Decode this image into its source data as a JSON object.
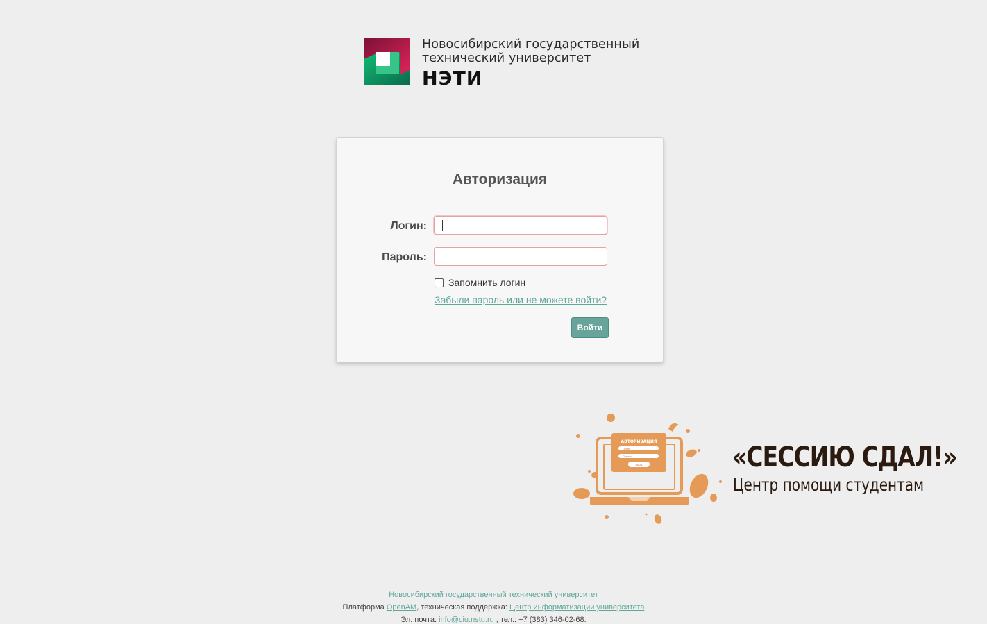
{
  "header": {
    "university_line1": "Новосибирский государственный",
    "university_line2": "технический университет",
    "abbr": "НЭТИ"
  },
  "auth_form": {
    "title": "Авторизация",
    "login_label": "Логин:",
    "login_value": "",
    "password_label": "Пароль:",
    "password_value": "",
    "remember_label": "Запомнить логин",
    "remember_checked": false,
    "forgot_link": "Забыли пароль или не можете войти?",
    "submit_label": "Войти"
  },
  "promo": {
    "title": "«СЕССИЮ СДАЛ!»",
    "subtitle": "Центр помощи студентам",
    "art_form_title": "АВТОРИЗАЦИЯ",
    "art_field1": "Логин",
    "art_field2": "Пароль",
    "art_button": "вход"
  },
  "footer": {
    "university_link": "Новосибирский государственный технический университет",
    "platform_prefix": "Платформа ",
    "platform_link": "OpenAM",
    "support_text": ", техническая поддержка: ",
    "support_link": "Центр информатизации университета",
    "email_prefix": "Эл. почта: ",
    "email_link": "info@ciu.nstu.ru",
    "phone_text": " , тел.: +7 (383) 346-02-68."
  },
  "colors": {
    "background": "#eeeeee",
    "accent_link": "#5fa799",
    "button": "#67a59a",
    "input_border": "#e3a3a3",
    "promo_orange": "#e69a57"
  }
}
